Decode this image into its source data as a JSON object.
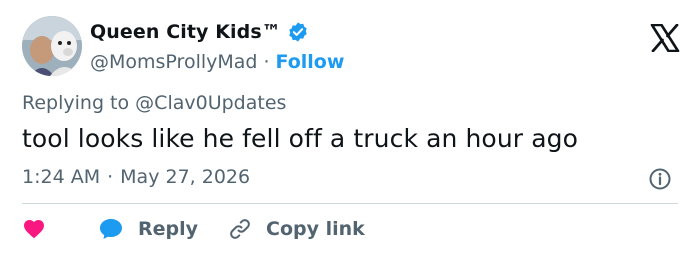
{
  "colors": {
    "text_primary": "#0f1419",
    "text_secondary": "#536471",
    "accent": "#1d9bf0",
    "like": "#f91880",
    "divider": "#cfd9de"
  },
  "author": {
    "display_name": "Queen City Kids™",
    "handle": "@MomsProllyMad",
    "separator": "·",
    "follow_label": "Follow",
    "verified_icon": "verified-badge-icon"
  },
  "reply_context": {
    "prefix": "Replying to",
    "mention": "@Clav0Updates"
  },
  "tweet": {
    "text": "tool looks like he fell off a truck an hour ago",
    "time": "1:24 AM",
    "separator": "·",
    "date": "May 27, 2026"
  },
  "actions": {
    "like_icon": "heart-icon",
    "reply_label": "Reply",
    "reply_icon": "speech-bubble-icon",
    "copy_label": "Copy link",
    "copy_icon": "link-icon"
  }
}
